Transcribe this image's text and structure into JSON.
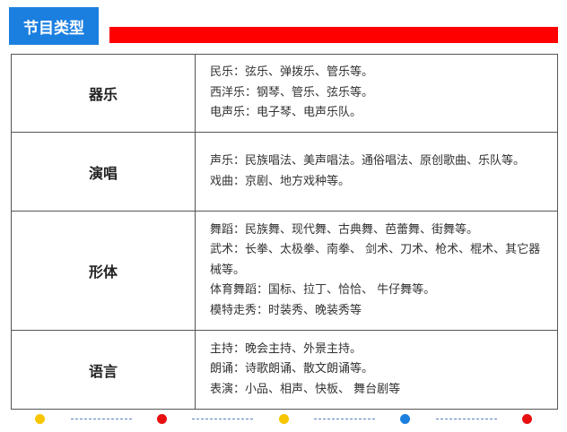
{
  "section_title": "节目类型",
  "colors": {
    "tab_blue": "#1b7fe0",
    "accent_red": "#ff0000",
    "dot_yellow": "#f7c400",
    "dot_red": "#e81010",
    "dot_blue": "#1b7fe0"
  },
  "rows": [
    {
      "category": "器乐",
      "lines": [
        "民乐：弦乐、弹拨乐、管乐等。",
        "西洋乐：钢琴、管乐、弦乐等。",
        "电声乐：电子琴、电声乐队。"
      ]
    },
    {
      "category": "演唱",
      "lines": [
        "声乐：民族唱法、美声唱法。通俗唱法、原创歌曲、乐队等。",
        "戏曲：京剧、地方戏种等。"
      ]
    },
    {
      "category": "形体",
      "lines": [
        "舞蹈：民族舞、现代舞、古典舞、芭蕾舞、街舞等。",
        "武术：长拳、太极拳、南拳、 剑术、刀术、枪术、棍术、其它器械等。",
        "体育舞蹈：国标、拉丁、恰恰、 牛仔舞等。",
        "模特走秀：时装秀、晚装秀等"
      ]
    },
    {
      "category": "语言",
      "lines": [
        "主持：晚会主持、外景主持。",
        "朗诵：诗歌朗诵、散文朗诵等。",
        "表演：小品、相声、快板、 舞台剧等"
      ]
    }
  ],
  "footer_dots": [
    "yellow",
    "red",
    "yellow",
    "blue",
    "red"
  ]
}
